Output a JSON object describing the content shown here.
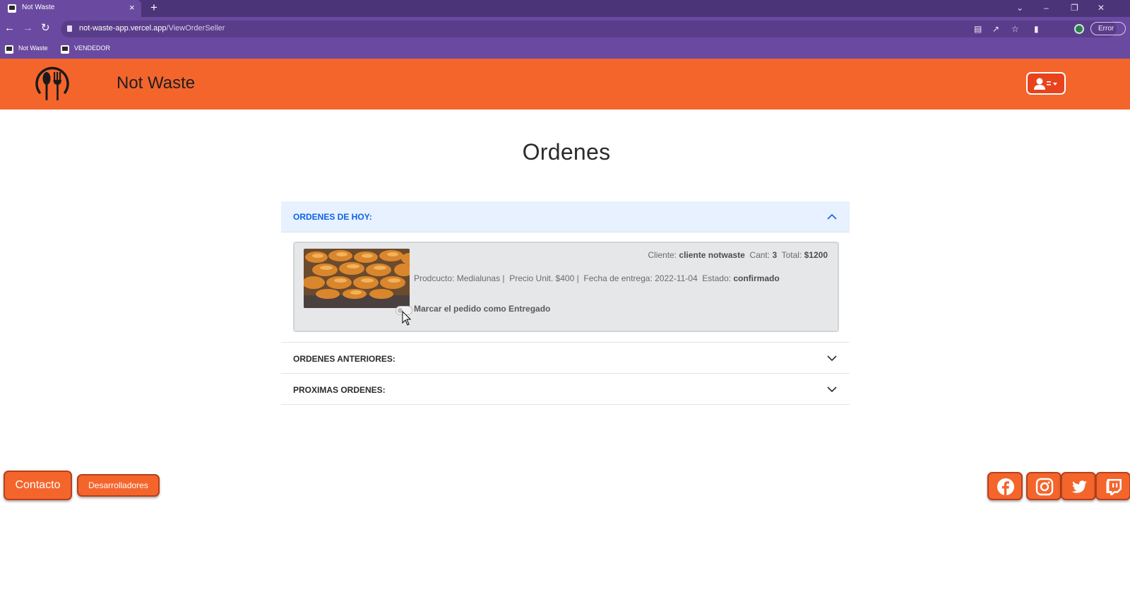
{
  "browser": {
    "tab_title": "Not Waste",
    "tab_close": "×",
    "new_tab": "+",
    "url_host": "not-waste-app.vercel.app",
    "url_path": "/ViewOrderSeller",
    "error_chip": "Error",
    "bookmarks": [
      {
        "label": "Not Waste"
      },
      {
        "label": "VENDEDOR"
      }
    ]
  },
  "navbar": {
    "brand": "Not Waste",
    "logo_icon": "fork-spoon-logo-icon",
    "user_menu_icon": "user-menu-icon"
  },
  "page": {
    "title": "Ordenes"
  },
  "accordion": {
    "today": {
      "label": "ORDENES DE HOY:",
      "expanded": true,
      "order": {
        "image": "croissants-image",
        "cliente_label": "Cliente:",
        "cliente_value": "cliente notwaste",
        "cant_label": "Cant:",
        "cant_value": "3",
        "total_label": "Total:",
        "total_value": "$1200",
        "producto_text": "Prodcucto: Medialunas |",
        "precio_text": "Precio Unit. $400 |",
        "fecha_text": "Fecha de entrega: 2022-11-04",
        "estado_label": "Estado:",
        "estado_value": "confirmado",
        "toggle_label": "Marcar el pedido como Entregado",
        "toggle_checked": false
      }
    },
    "previous": {
      "label": "ORDENES ANTERIORES:",
      "expanded": false
    },
    "upcoming": {
      "label": "PROXIMAS ORDENES:",
      "expanded": false
    }
  },
  "footer": {
    "contact_label": "Contacto",
    "devs_label": "Desarrolladores",
    "social": [
      "facebook-icon",
      "instagram-icon",
      "twitter-icon",
      "twitch-icon"
    ]
  },
  "colors": {
    "brand_orange": "#f4652c",
    "browser_purple": "#6a4aa0",
    "accordion_active": "#e7f1ff",
    "accordion_active_text": "#0c63e4"
  }
}
